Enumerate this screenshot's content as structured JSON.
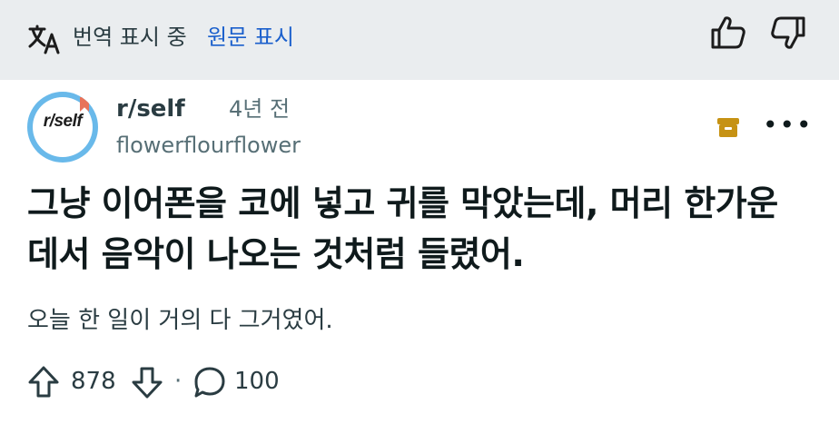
{
  "translation_bar": {
    "status_label": "번역 표시 중",
    "show_original_label": "원문 표시"
  },
  "post": {
    "subreddit": "r/self",
    "avatar_text": "r/self",
    "age": "4년 전",
    "username": "flowerflourflower",
    "title": "그냥 이어폰을 코에 넣고 귀를 막았는데, 머리 한가운데서 음악이 나오는 것처럼 들렸어.",
    "body": "오늘 한 일이 거의 다 그거였어.",
    "upvotes": "878",
    "comment_count": "100",
    "separator": "·",
    "more_label": "•••"
  },
  "colors": {
    "translate_bar_bg": "#eaedef",
    "link_blue": "#1a5fcc",
    "save_icon_gold": "#c69214",
    "avatar_ring": "#69b9ea"
  },
  "icons": [
    "translate-icon",
    "thumbs-up-icon",
    "thumbs-down-icon",
    "save-icon",
    "more-icon",
    "upvote-icon",
    "downvote-icon",
    "comment-icon"
  ]
}
